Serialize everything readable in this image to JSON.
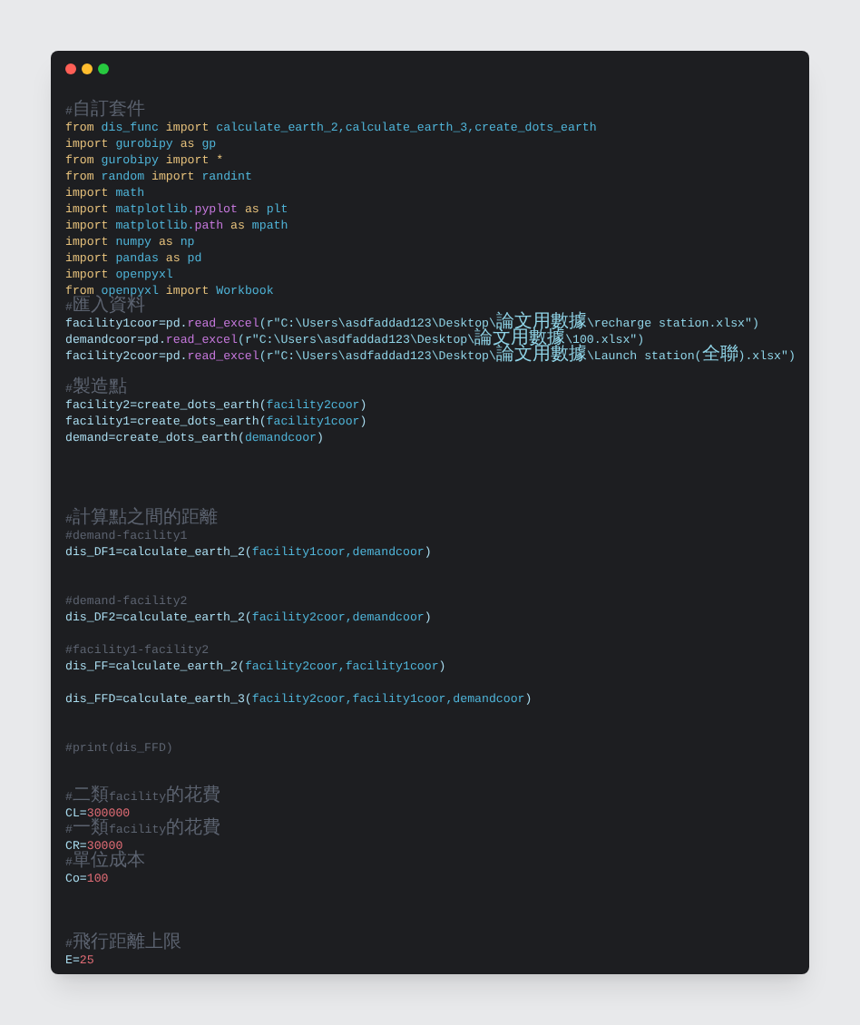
{
  "window": {
    "controls": [
      {
        "kind": "close"
      },
      {
        "kind": "minimize"
      },
      {
        "kind": "maximize"
      }
    ]
  },
  "code": [
    {
      "kind": "code",
      "tokens": [
        {
          "text": "#自訂套件",
          "kind": "comment"
        }
      ]
    },
    {
      "kind": "code",
      "tokens": [
        {
          "text": "from ",
          "kind": "keyword"
        },
        {
          "text": "dis_func ",
          "kind": "name"
        },
        {
          "text": "import ",
          "kind": "keyword"
        },
        {
          "text": "calculate_earth_2,calculate_earth_3,create_dots_earth",
          "kind": "name"
        }
      ]
    },
    {
      "kind": "code",
      "tokens": [
        {
          "text": "import ",
          "kind": "keyword"
        },
        {
          "text": "gurobipy ",
          "kind": "name"
        },
        {
          "text": "as ",
          "kind": "keyword"
        },
        {
          "text": "gp",
          "kind": "name"
        }
      ]
    },
    {
      "kind": "code",
      "tokens": [
        {
          "text": "from ",
          "kind": "keyword"
        },
        {
          "text": "gurobipy ",
          "kind": "name"
        },
        {
          "text": "import ",
          "kind": "keyword"
        },
        {
          "text": "*",
          "kind": "keyword"
        }
      ]
    },
    {
      "kind": "code",
      "tokens": [
        {
          "text": "from ",
          "kind": "keyword"
        },
        {
          "text": "random ",
          "kind": "name"
        },
        {
          "text": "import ",
          "kind": "keyword"
        },
        {
          "text": "randint",
          "kind": "name"
        }
      ]
    },
    {
      "kind": "code",
      "tokens": [
        {
          "text": "import ",
          "kind": "keyword"
        },
        {
          "text": "math",
          "kind": "name"
        }
      ]
    },
    {
      "kind": "code",
      "tokens": [
        {
          "text": "import ",
          "kind": "keyword"
        },
        {
          "text": "matplotlib.",
          "kind": "name"
        },
        {
          "text": "pyplot ",
          "kind": "function"
        },
        {
          "text": "as ",
          "kind": "keyword"
        },
        {
          "text": "plt",
          "kind": "name"
        }
      ]
    },
    {
      "kind": "code",
      "tokens": [
        {
          "text": "import ",
          "kind": "keyword"
        },
        {
          "text": "matplotlib.",
          "kind": "name"
        },
        {
          "text": "path ",
          "kind": "function"
        },
        {
          "text": "as ",
          "kind": "keyword"
        },
        {
          "text": "mpath",
          "kind": "name"
        }
      ]
    },
    {
      "kind": "code",
      "tokens": [
        {
          "text": "import ",
          "kind": "keyword"
        },
        {
          "text": "numpy ",
          "kind": "name"
        },
        {
          "text": "as ",
          "kind": "keyword"
        },
        {
          "text": "np",
          "kind": "name"
        }
      ]
    },
    {
      "kind": "code",
      "tokens": [
        {
          "text": "import ",
          "kind": "keyword"
        },
        {
          "text": "pandas ",
          "kind": "name"
        },
        {
          "text": "as ",
          "kind": "keyword"
        },
        {
          "text": "pd",
          "kind": "name"
        }
      ]
    },
    {
      "kind": "code",
      "tokens": [
        {
          "text": "import ",
          "kind": "keyword"
        },
        {
          "text": "openpyxl",
          "kind": "name"
        }
      ]
    },
    {
      "kind": "code",
      "tokens": [
        {
          "text": "from ",
          "kind": "keyword"
        },
        {
          "text": "openpyxl ",
          "kind": "name"
        },
        {
          "text": "import ",
          "kind": "keyword"
        },
        {
          "text": "Workbook",
          "kind": "name"
        }
      ]
    },
    {
      "kind": "code",
      "tokens": [
        {
          "text": "#匯入資料",
          "kind": "comment"
        }
      ]
    },
    {
      "kind": "code",
      "tokens": [
        {
          "text": "facility1coor=pd.",
          "kind": "variable"
        },
        {
          "text": "read_excel",
          "kind": "function"
        },
        {
          "text": "(r\"C:\\Users\\asdfaddad123\\Desktop\\論文用數據\\recharge station.xlsx\")",
          "kind": "string"
        }
      ]
    },
    {
      "kind": "code",
      "tokens": [
        {
          "text": "demandcoor=pd.",
          "kind": "variable"
        },
        {
          "text": "read_excel",
          "kind": "function"
        },
        {
          "text": "(r\"C:\\Users\\asdfaddad123\\Desktop\\論文用數據\\100.xlsx\")",
          "kind": "string"
        }
      ]
    },
    {
      "kind": "code",
      "tokens": [
        {
          "text": "facility2coor=pd.",
          "kind": "variable"
        },
        {
          "text": "read_excel",
          "kind": "function"
        },
        {
          "text": "(r\"C:\\Users\\asdfaddad123\\Desktop\\論文用數據\\Launch station(全聯).xlsx\")",
          "kind": "string"
        }
      ]
    },
    {
      "kind": "blank"
    },
    {
      "kind": "code",
      "tokens": [
        {
          "text": "#製造點",
          "kind": "comment"
        }
      ]
    },
    {
      "kind": "code",
      "tokens": [
        {
          "text": "facility2=create_dots_earth(",
          "kind": "variable"
        },
        {
          "text": "facility2coor",
          "kind": "name"
        },
        {
          "text": ")",
          "kind": "variable"
        }
      ]
    },
    {
      "kind": "code",
      "tokens": [
        {
          "text": "facility1=create_dots_earth(",
          "kind": "variable"
        },
        {
          "text": "facility1coor",
          "kind": "name"
        },
        {
          "text": ")",
          "kind": "variable"
        }
      ]
    },
    {
      "kind": "code",
      "tokens": [
        {
          "text": "demand=create_dots_earth(",
          "kind": "variable"
        },
        {
          "text": "demandcoor",
          "kind": "name"
        },
        {
          "text": ")",
          "kind": "variable"
        }
      ]
    },
    {
      "kind": "blank"
    },
    {
      "kind": "blank"
    },
    {
      "kind": "blank"
    },
    {
      "kind": "blank"
    },
    {
      "kind": "code",
      "tokens": [
        {
          "text": "#計算點之間的距離",
          "kind": "comment"
        }
      ]
    },
    {
      "kind": "code",
      "tokens": [
        {
          "text": "#demand-facility1",
          "kind": "comment"
        }
      ]
    },
    {
      "kind": "code",
      "tokens": [
        {
          "text": "dis_DF1=calculate_earth_2(",
          "kind": "variable"
        },
        {
          "text": "facility1coor,demandcoor",
          "kind": "name"
        },
        {
          "text": ")",
          "kind": "variable"
        }
      ]
    },
    {
      "kind": "blank"
    },
    {
      "kind": "blank"
    },
    {
      "kind": "code",
      "tokens": [
        {
          "text": "#demand-facility2",
          "kind": "comment"
        }
      ]
    },
    {
      "kind": "code",
      "tokens": [
        {
          "text": "dis_DF2=calculate_earth_2(",
          "kind": "variable"
        },
        {
          "text": "facility2coor,demandcoor",
          "kind": "name"
        },
        {
          "text": ")",
          "kind": "variable"
        }
      ]
    },
    {
      "kind": "blank"
    },
    {
      "kind": "code",
      "tokens": [
        {
          "text": "#facility1-facility2",
          "kind": "comment"
        }
      ]
    },
    {
      "kind": "code",
      "tokens": [
        {
          "text": "dis_FF=calculate_earth_2(",
          "kind": "variable"
        },
        {
          "text": "facility2coor,facility1coor",
          "kind": "name"
        },
        {
          "text": ")",
          "kind": "variable"
        }
      ]
    },
    {
      "kind": "blank"
    },
    {
      "kind": "code",
      "tokens": [
        {
          "text": "dis_FFD=calculate_earth_3(",
          "kind": "variable"
        },
        {
          "text": "facility2coor,facility1coor,demandcoor",
          "kind": "name"
        },
        {
          "text": ")",
          "kind": "variable"
        }
      ]
    },
    {
      "kind": "blank"
    },
    {
      "kind": "blank"
    },
    {
      "kind": "code",
      "tokens": [
        {
          "text": "#print(dis_FFD)",
          "kind": "comment"
        }
      ]
    },
    {
      "kind": "blank"
    },
    {
      "kind": "blank"
    },
    {
      "kind": "code",
      "tokens": [
        {
          "text": "#二類facility的花費",
          "kind": "comment"
        }
      ]
    },
    {
      "kind": "code",
      "tokens": [
        {
          "text": "CL=",
          "kind": "variable"
        },
        {
          "text": "300000",
          "kind": "number"
        }
      ]
    },
    {
      "kind": "code",
      "tokens": [
        {
          "text": "#一類facility的花費",
          "kind": "comment"
        }
      ]
    },
    {
      "kind": "code",
      "tokens": [
        {
          "text": "CR=",
          "kind": "variable"
        },
        {
          "text": "30000",
          "kind": "number"
        }
      ]
    },
    {
      "kind": "code",
      "tokens": [
        {
          "text": "#單位成本",
          "kind": "comment"
        }
      ]
    },
    {
      "kind": "code",
      "tokens": [
        {
          "text": "Co=",
          "kind": "variable"
        },
        {
          "text": "100",
          "kind": "number"
        }
      ]
    },
    {
      "kind": "blank"
    },
    {
      "kind": "blank"
    },
    {
      "kind": "blank"
    },
    {
      "kind": "code",
      "tokens": [
        {
          "text": "#飛行距離上限",
          "kind": "comment"
        }
      ]
    },
    {
      "kind": "code",
      "tokens": [
        {
          "text": "E=",
          "kind": "variable"
        },
        {
          "text": "25",
          "kind": "number"
        }
      ]
    }
  ]
}
